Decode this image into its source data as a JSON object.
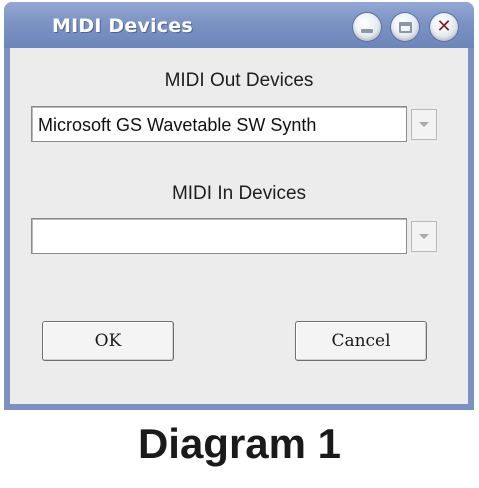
{
  "window": {
    "title": "MIDI Devices",
    "controls": {
      "minimize_icon": "minimize-icon",
      "maximize_icon": "maximize-icon",
      "close_icon": "close-icon",
      "close_glyph": "✕"
    }
  },
  "midi_out": {
    "label": "MIDI Out Devices",
    "selected": "Microsoft GS Wavetable SW Synth"
  },
  "midi_in": {
    "label": "MIDI In Devices",
    "selected": ""
  },
  "buttons": {
    "ok": "OK",
    "cancel": "Cancel"
  },
  "caption": "Diagram 1",
  "colors": {
    "titlebar": "#7c93c4",
    "client": "#ececec",
    "close_glyph": "#7a1f1f"
  }
}
